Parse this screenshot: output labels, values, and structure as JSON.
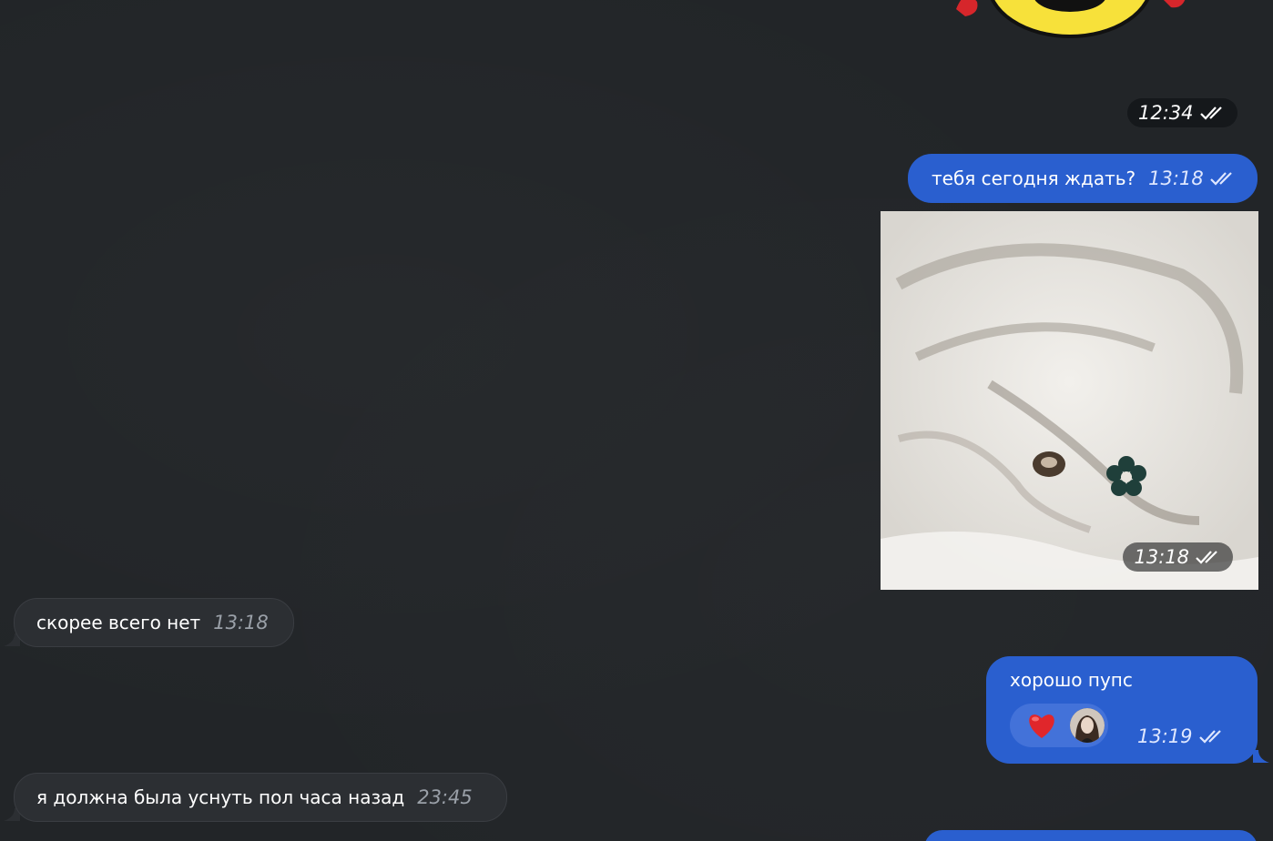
{
  "messages": [
    {
      "direction": "out",
      "kind": "sticker",
      "time": "12:34"
    },
    {
      "direction": "out",
      "kind": "text",
      "text": "тебя сегодня ждать?",
      "time": "13:18"
    },
    {
      "direction": "out",
      "kind": "image",
      "time": "13:18"
    },
    {
      "direction": "in",
      "kind": "text",
      "text": "скорее всего нет",
      "time": "13:18"
    },
    {
      "direction": "out",
      "kind": "text",
      "text": "хорошо пупс",
      "time": "13:19",
      "reaction": "heart"
    },
    {
      "direction": "in",
      "kind": "text",
      "text": "я должна была уснуть пол часа назад",
      "time": "23:45"
    }
  ],
  "colors": {
    "background": "#222528",
    "outgoing_bubble": "#2a5fcf",
    "incoming_bubble": "#2c2f33",
    "reaction_heart": "#e0262b"
  },
  "icons": {
    "read_receipt": "double-check-icon",
    "reaction": "heart-icon"
  }
}
